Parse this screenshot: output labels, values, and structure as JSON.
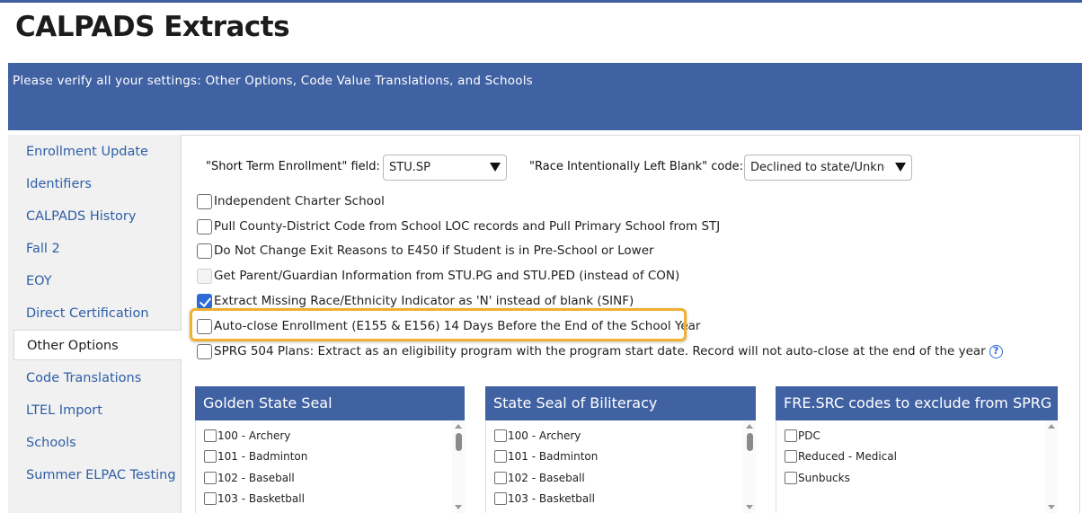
{
  "page": {
    "title": "CALPADS Extracts"
  },
  "banner": {
    "text": "Please verify all your settings: Other Options, Code Value Translations, and Schools"
  },
  "sidebar": {
    "items": [
      {
        "label": "Enrollment Update"
      },
      {
        "label": "Identifiers"
      },
      {
        "label": "CALPADS History"
      },
      {
        "label": "Fall 2"
      },
      {
        "label": "EOY"
      },
      {
        "label": "Direct Certification"
      },
      {
        "label": "Other Options",
        "active": true
      },
      {
        "label": "Code Translations"
      },
      {
        "label": "LTEL Import"
      },
      {
        "label": "Schools"
      },
      {
        "label": "Summer ELPAC Testing"
      }
    ]
  },
  "fields": {
    "short_term": {
      "label": "\"Short Term Enrollment\" field:",
      "value": "STU.SP"
    },
    "race_blank": {
      "label": "\"Race Intentionally Left Blank\" code:",
      "value": "Declined to state/Unknown"
    }
  },
  "options": [
    {
      "label": "Independent Charter School",
      "checked": false
    },
    {
      "label": "Pull County-District Code from School LOC records and Pull Primary School from STJ",
      "checked": false
    },
    {
      "label": "Do Not Change Exit Reasons to E450 if Student is in Pre-School or Lower",
      "checked": false
    },
    {
      "label": "Get Parent/Guardian Information from STU.PG and STU.PED (instead of CON)",
      "checked": false,
      "disabled": true
    },
    {
      "label": "Extract Missing Race/Ethnicity Indicator as 'N' instead of blank (SINF)",
      "checked": true
    },
    {
      "label": "Auto-close Enrollment (E155 & E156) 14 Days Before the End of the School Year",
      "checked": false,
      "highlighted": true
    },
    {
      "label": "SPRG 504 Plans: Extract as an eligibility program with the program start date. Record will not auto-close at the end of the year",
      "checked": false,
      "help_icon": "question-circle-icon"
    }
  ],
  "panels": {
    "golden_state_seal": {
      "title": "Golden State Seal",
      "items": [
        "100 - Archery",
        "101 - Badminton",
        "102 - Baseball",
        "103 - Basketball"
      ]
    },
    "state_seal_biliteracy": {
      "title": "State Seal of Biliteracy",
      "items": [
        "100 - Archery",
        "101 - Badminton",
        "102 - Baseball",
        "103 - Basketball"
      ]
    },
    "fre_src_exclude": {
      "title": "FRE.SRC codes to exclude from SPRG",
      "items": [
        "PDC",
        "Reduced - Medical",
        "Sunbucks"
      ]
    }
  },
  "colors": {
    "accent": "#4062a3",
    "link": "#2f5ea6",
    "highlight": "#f0b030",
    "checkbox_checked": "#2f6bd6"
  }
}
